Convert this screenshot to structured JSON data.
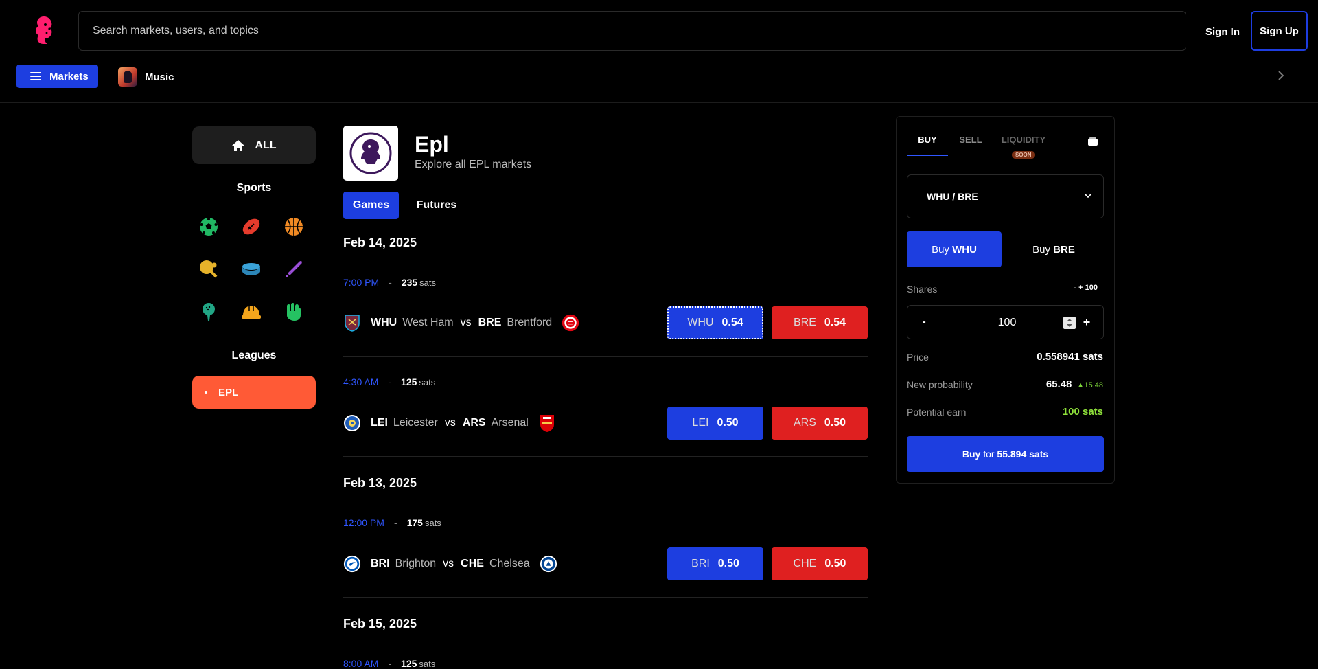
{
  "header": {
    "search_placeholder": "Search markets, users, and topics",
    "sign_in": "Sign In",
    "sign_up": "Sign Up"
  },
  "catbar": {
    "markets": "Markets",
    "music": "Music"
  },
  "sidebar": {
    "all": "ALL",
    "sports_title": "Sports",
    "sports_icons": [
      "soccer-icon",
      "football-icon",
      "basketball-icon",
      "ping-pong-icon",
      "hockey-puck-icon",
      "baseball-bat-icon",
      "golf-icon",
      "helmet-icon",
      "fist-icon"
    ],
    "leagues_title": "Leagues",
    "league_active": "EPL"
  },
  "league": {
    "title": "Epl",
    "subtitle": "Explore all EPL markets",
    "tab_games": "Games",
    "tab_futures": "Futures"
  },
  "games": [
    {
      "date": "Feb 14, 2025",
      "time": "7:00 PM",
      "sep": "-",
      "volume": "235",
      "unit": "sats",
      "home_abbr": "WHU",
      "home_name": "West Ham",
      "vs": "vs",
      "away_abbr": "BRE",
      "away_name": "Brentford",
      "home_price": "0.54",
      "away_price": "0.54"
    },
    {
      "time": "4:30 AM",
      "sep": "-",
      "volume": "125",
      "unit": "sats",
      "home_abbr": "LEI",
      "home_name": "Leicester",
      "vs": "vs",
      "away_abbr": "ARS",
      "away_name": "Arsenal",
      "home_price": "0.50",
      "away_price": "0.50"
    },
    {
      "date": "Feb 13, 2025",
      "time": "12:00 PM",
      "sep": "-",
      "volume": "175",
      "unit": "sats",
      "home_abbr": "BRI",
      "home_name": "Brighton",
      "vs": "vs",
      "away_abbr": "CHE",
      "away_name": "Chelsea",
      "home_price": "0.50",
      "away_price": "0.50"
    },
    {
      "date": "Feb 15, 2025",
      "time": "8:00 AM",
      "sep": "-",
      "volume": "125",
      "unit": "sats"
    }
  ],
  "trade": {
    "tab_buy": "BUY",
    "tab_sell": "SELL",
    "tab_liquidity": "LIQUIDITY",
    "soon": "SOON",
    "pair": "WHU / BRE",
    "buy_prefix": "Buy",
    "buy_home": "WHU",
    "buy_away": "BRE",
    "shares_label": "Shares",
    "shares_adj": "- + 100",
    "shares_value": "100",
    "minus": "-",
    "plus": "+",
    "price_label": "Price",
    "price_value": "0.558941 sats",
    "prob_label": "New probability",
    "prob_value": "65.48",
    "prob_delta": "15.48",
    "earn_label": "Potential earn",
    "earn_value": "100 sats",
    "cta_prefix": "Buy",
    "cta_for": "for",
    "cta_amount": "55.894 sats"
  },
  "colors": {
    "accent_blue": "#1d3ee0",
    "away_red": "#df2020",
    "league_orange": "#ff5a36",
    "positive_green": "#8ee03a"
  }
}
